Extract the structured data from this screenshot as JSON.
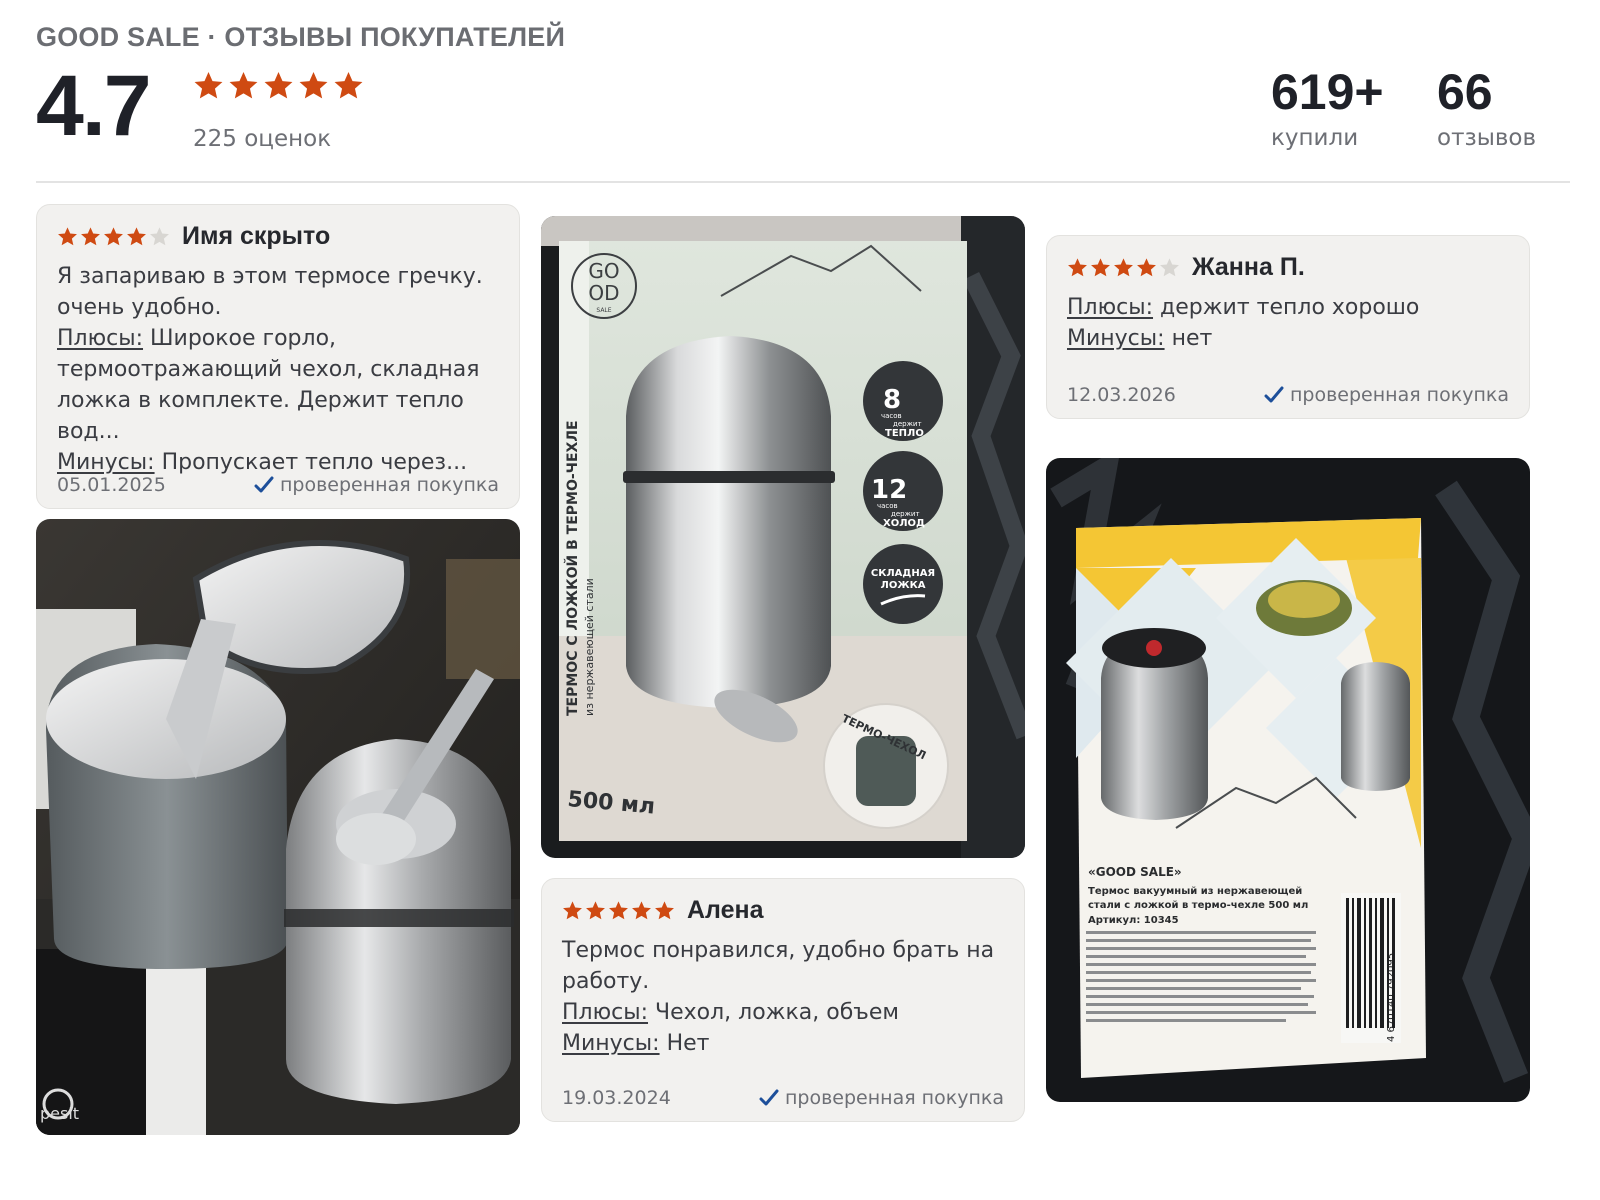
{
  "header": {
    "title": "GOOD SALE · ОТЗЫВЫ ПОКУПАТЕЛЕЙ",
    "rating": "4.7",
    "rating_value": 4.7,
    "ratings_count": "225 оценок",
    "bought_value": "619+",
    "bought_label": "купили",
    "reviews_value": "66",
    "reviews_label": "отзывов"
  },
  "colors": {
    "star": "#cf4a12",
    "star_empty": "#d8d6d2",
    "check": "#1d4f9a"
  },
  "labels": {
    "pros": "Плюсы:",
    "cons": "Минусы:",
    "verified": "проверенная покупка"
  },
  "reviews": [
    {
      "author": "Имя скрыто",
      "stars": 4,
      "text": "Я запариваю в этом термосе гречку. очень удобно.",
      "pros": "Широкое горло, термоотражающий чехол, складная ложка в комплекте. Держит тепло вод...",
      "cons": "Пропускает тепло через...",
      "date": "05.01.2025"
    },
    {
      "author": "Алена",
      "stars": 5,
      "text": "Термос понравился, удобно брать на работу.",
      "pros": "Чехол, ложка, объем",
      "cons": "Нет",
      "date": "19.03.2024"
    },
    {
      "author": "Жанна П.",
      "stars": 4,
      "pros": "держит тепло хорошо",
      "cons": "нет",
      "date": "12.03.2026"
    }
  ],
  "photos": {
    "box_front": {
      "brand_top": "GO",
      "brand_bottom": "OD",
      "brand_small": "SALE",
      "vertical_title": "ТЕРМОС С ЛОЖКОЙ В ТЕРМО-ЧЕХЛЕ",
      "vertical_sub": "из нержавеющей стали",
      "volume": "500 мл",
      "badge1_num": "8",
      "badge1_small": "часов",
      "badge1_word": "держит",
      "badge1_label": "ТЕПЛО",
      "badge2_num": "12",
      "badge2_small": "часов",
      "badge2_word": "держит",
      "badge2_label": "ХОЛОД",
      "badge3_line1": "СКЛАДНАЯ",
      "badge3_line2": "ЛОЖКА",
      "case_label": "ТЕРМО-ЧЕХОЛ"
    },
    "box_back": {
      "brand": "«GOOD SALE»",
      "desc1": "Термос вакуумный из нержавеющей",
      "desc2": "стали с ложкой в термо-чехле 500 мл",
      "article": "Артикул: 10345",
      "barcode": "4 670140 792095"
    },
    "kitchen": {
      "hob_brand": "pesit"
    }
  }
}
